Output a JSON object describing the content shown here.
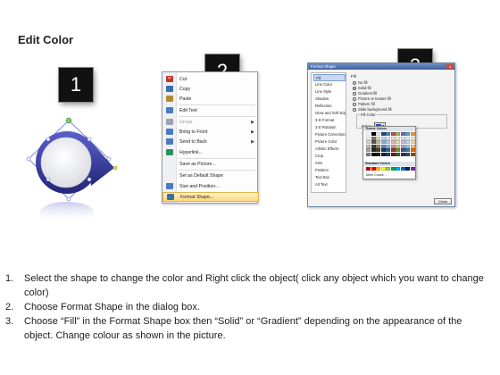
{
  "title": "Edit Color",
  "steps": [
    "1",
    "2",
    "3"
  ],
  "context_menu": {
    "items": [
      {
        "label": "Cut",
        "icon": "scissors-icon",
        "color": "#c0392b"
      },
      {
        "label": "Copy",
        "icon": "copy-icon",
        "color": "#3d6cb3"
      },
      {
        "label": "Paste",
        "icon": "paste-icon",
        "color": "#b5892e"
      },
      {
        "label": "Edit Text",
        "icon": "edit-text-icon",
        "color": "#4a7bbd"
      },
      {
        "label": "Group",
        "icon": "group-icon",
        "color": "#9aa4b2",
        "disabled": true,
        "submenu": true
      },
      {
        "label": "Bring to Front",
        "icon": "bring-front-icon",
        "color": "#4a7bbd",
        "submenu": true
      },
      {
        "label": "Send to Back",
        "icon": "send-back-icon",
        "color": "#4a7bbd",
        "submenu": true
      },
      {
        "label": "Hyperlink...",
        "icon": "hyperlink-icon",
        "color": "#2f8f5b"
      },
      {
        "label": "Save as Picture...",
        "icon": "",
        "color": ""
      },
      {
        "label": "Set as Default Shape",
        "icon": "",
        "color": ""
      },
      {
        "label": "Size and Position...",
        "icon": "size-position-icon",
        "color": "#4a7bbd"
      },
      {
        "label": "Format Shape...",
        "icon": "format-shape-icon",
        "color": "#3d6cb3",
        "selected": true
      }
    ]
  },
  "dialog": {
    "title": "Format Shape",
    "close_x": "x",
    "categories": [
      "Fill",
      "Line Color",
      "Line Style",
      "Shadow",
      "Reflection",
      "Glow and Soft Edges",
      "3-D Format",
      "3-D Rotation",
      "Picture Corrections",
      "Picture Color",
      "Artistic Effects",
      "Crop",
      "Size",
      "Position",
      "Text Box",
      "Alt Text"
    ],
    "active_category": 0,
    "heading": "Fill",
    "options": [
      "No fill",
      "Solid fill",
      "Gradient fill",
      "Picture or texture fill",
      "Pattern fill",
      "Slide background fill"
    ],
    "selected_option": 1,
    "fill_color_group": "Fill Color",
    "color_label": "Color:",
    "transparency_label": "Transparency:",
    "close_button": "Close"
  },
  "picker": {
    "theme_label": "Theme Colors",
    "standard_label": "Standard Colors",
    "more_label": "More Colors...",
    "theme_colors": [
      "#ffffff",
      "#000000",
      "#eeece1",
      "#1f497d",
      "#4f81bd",
      "#c0504d",
      "#9bbb59",
      "#8064a2",
      "#4bacc6",
      "#f79646",
      "#f2f2f2",
      "#7f7f7f",
      "#ddd9c3",
      "#c6d9f0",
      "#dbe5f1",
      "#f2dcdb",
      "#ebf1dd",
      "#e5e0ec",
      "#dbeef3",
      "#fdeada",
      "#d8d8d8",
      "#595959",
      "#c4bd97",
      "#8db3e2",
      "#b8cce4",
      "#e5b9b7",
      "#d7e3bc",
      "#ccc1d9",
      "#b7dde8",
      "#fbd5b5",
      "#bfbfbf",
      "#3f3f3f",
      "#938953",
      "#548dd4",
      "#95b3d7",
      "#d99694",
      "#c3d69b",
      "#b2a2c7",
      "#92cddc",
      "#fac08f",
      "#a5a5a5",
      "#262626",
      "#494429",
      "#17365d",
      "#366092",
      "#953734",
      "#76923c",
      "#5f497a",
      "#31859b",
      "#e36c09",
      "#7f7f7f",
      "#0c0c0c",
      "#1d1b10",
      "#0f243e",
      "#244061",
      "#632423",
      "#4f6128",
      "#3f3151",
      "#205867",
      "#974806"
    ],
    "standard_colors": [
      "#c00000",
      "#ff0000",
      "#ffc000",
      "#ffff00",
      "#92d050",
      "#00b050",
      "#00b0f0",
      "#0070c0",
      "#002060",
      "#7030a0"
    ]
  },
  "shape": {
    "ring_color": "#3b3fa6",
    "fill_color": "#f4f4f6",
    "outline_color": "#5a6ad0",
    "handle_color": "#7fc86a"
  },
  "instructions": [
    {
      "num": "1.",
      "text": "Select the shape to change the color and Right click the object( click any object which you want to change color)"
    },
    {
      "num": "2.",
      "text": "Choose Format Shape in the dialog box."
    },
    {
      "num": "3.",
      "text": "Choose “Fill” in the Format Shape box then “Solid” or “Gradient” depending on the appearance of the object. Change colour as shown in the picture."
    }
  ]
}
